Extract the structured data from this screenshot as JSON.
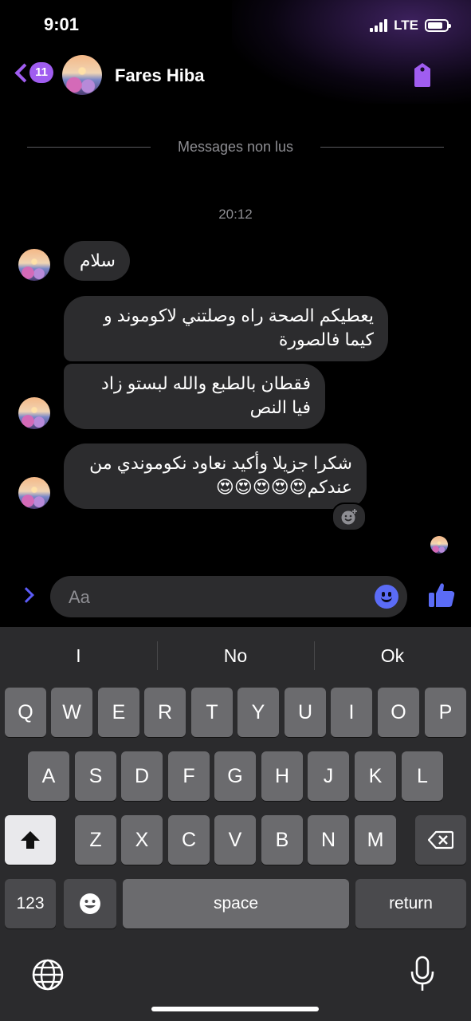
{
  "status_bar": {
    "time": "9:01",
    "network": "LTE"
  },
  "header": {
    "back_count": "11",
    "name": "Fares Hiba"
  },
  "thread": {
    "unread_label": "Messages non lus",
    "time_separator": "20:12",
    "messages": [
      {
        "text": "سلام"
      },
      {
        "text": "يعطيكم الصحة راه وصلتني لاكوموند و كيما فالصورة"
      },
      {
        "text": "فقطان بالطبع والله لبستو زاد فيا النص"
      },
      {
        "text": "شكرا جزيلا وأكيد نعاود نكوموندي من عندكم😍😍😍😍😍"
      }
    ]
  },
  "composer": {
    "placeholder": "Aa"
  },
  "keyboard": {
    "suggestions": [
      "I",
      "No",
      "Ok"
    ],
    "row1": [
      "Q",
      "W",
      "E",
      "R",
      "T",
      "Y",
      "U",
      "I",
      "O",
      "P"
    ],
    "row2": [
      "A",
      "S",
      "D",
      "F",
      "G",
      "H",
      "J",
      "K",
      "L"
    ],
    "row3": [
      "Z",
      "X",
      "C",
      "V",
      "B",
      "N",
      "M"
    ],
    "numbers_label": "123",
    "space_label": "space",
    "return_label": "return"
  },
  "colors": {
    "accent": "#a05df0",
    "bubble": "#2c2c2e",
    "composer_icon": "#5b6cf6"
  },
  "icons": [
    "back-chevron-icon",
    "tag-icon",
    "send-chevron-icon",
    "smiley-icon",
    "thumbs-up-icon",
    "shift-icon",
    "backspace-icon",
    "emoji-icon",
    "globe-icon",
    "microphone-icon",
    "add-reaction-icon"
  ]
}
